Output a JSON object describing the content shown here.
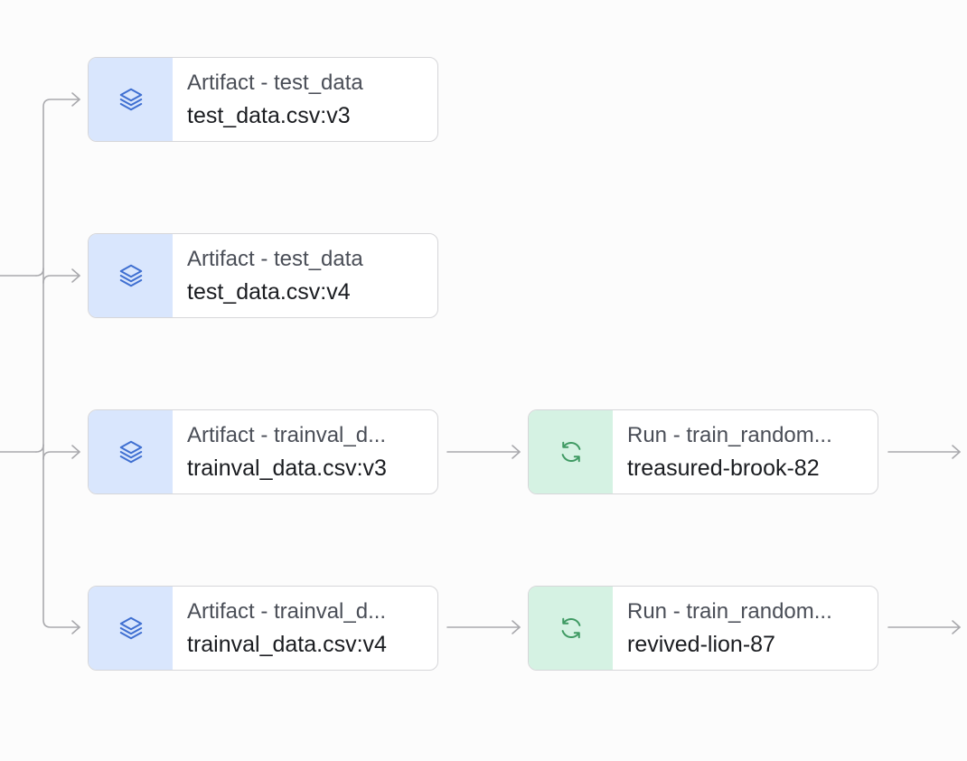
{
  "colors": {
    "artifact_icon_bg": "#d9e6fd",
    "artifact_icon": "#3f6fd1",
    "run_icon_bg": "#d5f2e3",
    "run_icon": "#3f9a63",
    "edge": "#a9a9ad"
  },
  "nodes": [
    {
      "kind": "Artifact - test_data",
      "name": "test_data.csv:v3",
      "icon": "layers-icon"
    },
    {
      "kind": "Artifact - test_data",
      "name": "test_data.csv:v4",
      "icon": "layers-icon"
    },
    {
      "kind": "Artifact - trainval_d...",
      "name": "trainval_data.csv:v3",
      "icon": "layers-icon"
    },
    {
      "kind": "Artifact - trainval_d...",
      "name": "trainval_data.csv:v4",
      "icon": "layers-icon"
    },
    {
      "kind": "Run - train_random...",
      "name": "treasured-brook-82",
      "icon": "refresh-icon"
    },
    {
      "kind": "Run - train_random...",
      "name": "revived-lion-87",
      "icon": "refresh-icon"
    }
  ]
}
